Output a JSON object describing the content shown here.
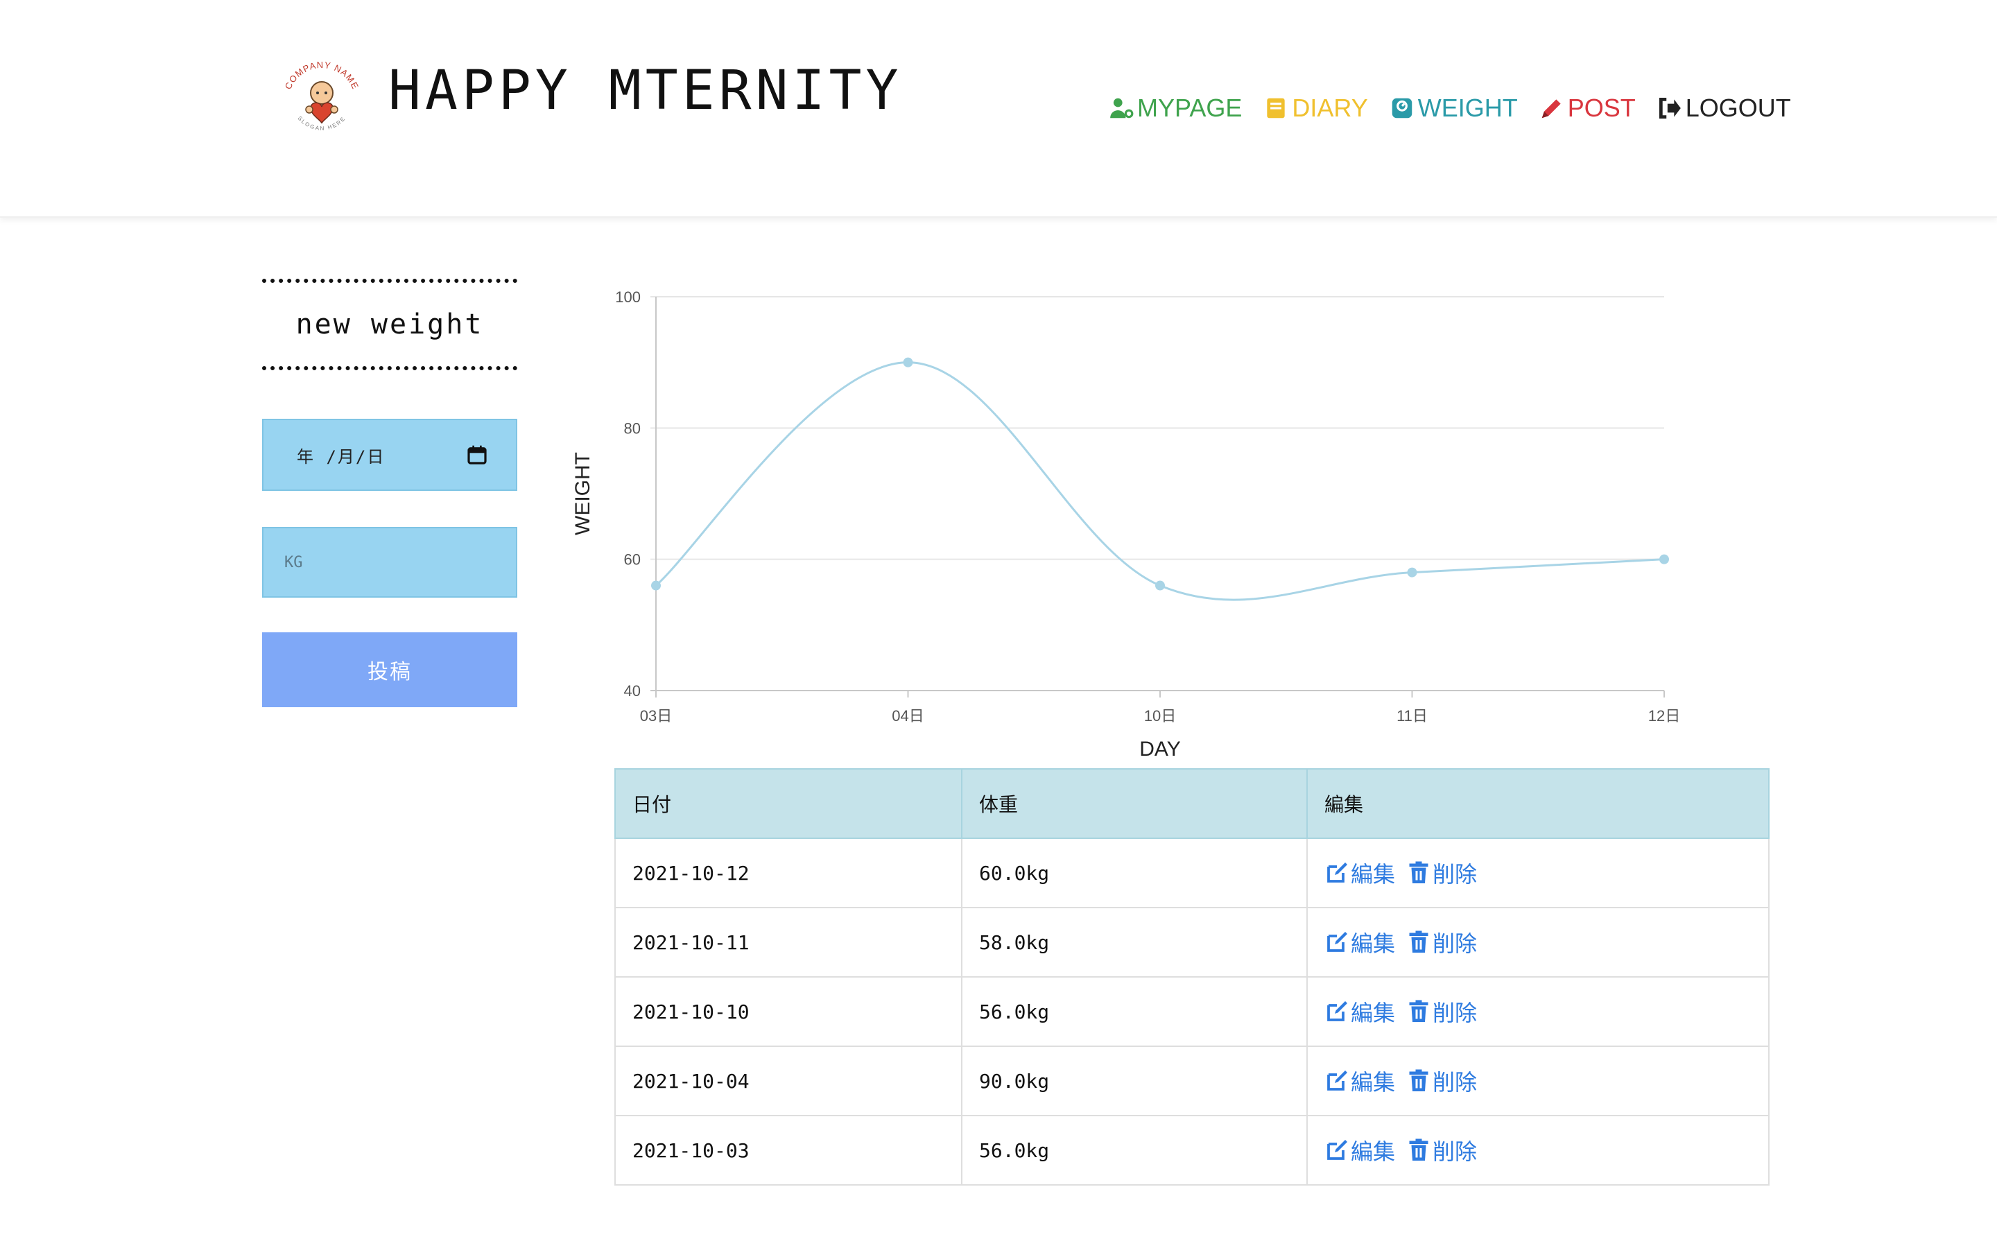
{
  "header": {
    "title": "HAPPY MTERNITY",
    "logo": {
      "top_text": "COMPANY NAME",
      "bottom_text": "SLOGAN HERE",
      "icon": "baby-heart-logo"
    }
  },
  "nav": [
    {
      "label": "MYPAGE",
      "icon": "user-gear-icon",
      "color": "#3fa34d"
    },
    {
      "label": "DIARY",
      "icon": "book-icon",
      "color": "#f0c02e"
    },
    {
      "label": "WEIGHT",
      "icon": "scale-icon",
      "color": "#2a9aa8"
    },
    {
      "label": "POST",
      "icon": "pencil-icon",
      "color": "#d9363e"
    },
    {
      "label": "LOGOUT",
      "icon": "logout-icon",
      "color": "#222222"
    }
  ],
  "form": {
    "title": "new weight",
    "date_placeholder": "年 /月/日",
    "kg_placeholder": "KG",
    "submit_label": "投稿"
  },
  "chart_data": {
    "type": "line",
    "categories": [
      "03日",
      "04日",
      "10日",
      "11日",
      "12日"
    ],
    "series": [
      {
        "values": [
          56,
          90,
          56,
          58,
          60
        ],
        "color": "#a8d4e6"
      }
    ],
    "xlabel": "DAY",
    "ylabel": "WEIGHT",
    "ylim": [
      40,
      100
    ],
    "yticks": [
      40,
      60,
      80,
      100
    ],
    "grid": true,
    "smooth": true
  },
  "table": {
    "headers": [
      "日付",
      "体重",
      "編集"
    ],
    "edit_label": "編集",
    "delete_label": "削除",
    "rows": [
      {
        "date": "2021-10-12",
        "weight": "60.0kg"
      },
      {
        "date": "2021-10-11",
        "weight": "58.0kg"
      },
      {
        "date": "2021-10-10",
        "weight": "56.0kg"
      },
      {
        "date": "2021-10-04",
        "weight": "90.0kg"
      },
      {
        "date": "2021-10-03",
        "weight": "56.0kg"
      }
    ]
  }
}
